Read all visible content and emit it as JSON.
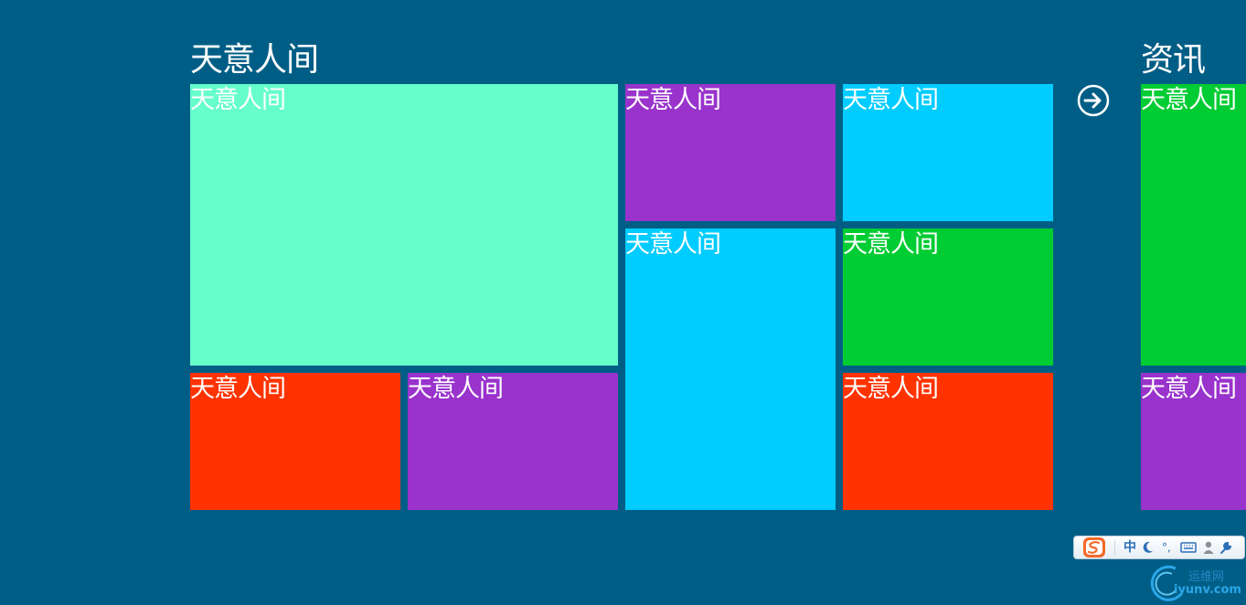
{
  "groups": [
    {
      "title": "天意人间",
      "tiles": [
        {
          "label": "天意人间",
          "color": "#66ffcc"
        },
        {
          "label": "天意人间",
          "color": "#9933cc"
        },
        {
          "label": "天意人间",
          "color": "#00ccff"
        },
        {
          "label": "天意人间",
          "color": "#00ccff"
        },
        {
          "label": "天意人间",
          "color": "#00cc33"
        },
        {
          "label": "天意人间",
          "color": "#ff3300"
        },
        {
          "label": "天意人间",
          "color": "#9933cc"
        },
        {
          "label": "天意人间",
          "color": "#ff3300"
        }
      ]
    },
    {
      "title": "资讯",
      "tiles": [
        {
          "label": "天意人间",
          "color": "#00cc33"
        },
        {
          "label": "天意人间",
          "color": "#9933cc"
        }
      ]
    }
  ],
  "navigation": {
    "next_icon": "arrow-right-circle-icon"
  },
  "ime_toolbar": {
    "logo_icon": "sogou-s-icon",
    "mode": "中",
    "moon_icon": "half-width-moon-icon",
    "punct": "°,",
    "keyboard_icon": "keyboard-icon",
    "user_icon": "user-icon",
    "tool_icon": "wrench-icon"
  },
  "watermark": {
    "cn": "运维网",
    "en": "iyunv.com"
  },
  "colors": {
    "background": "#005e86",
    "text": "#ffffff"
  }
}
